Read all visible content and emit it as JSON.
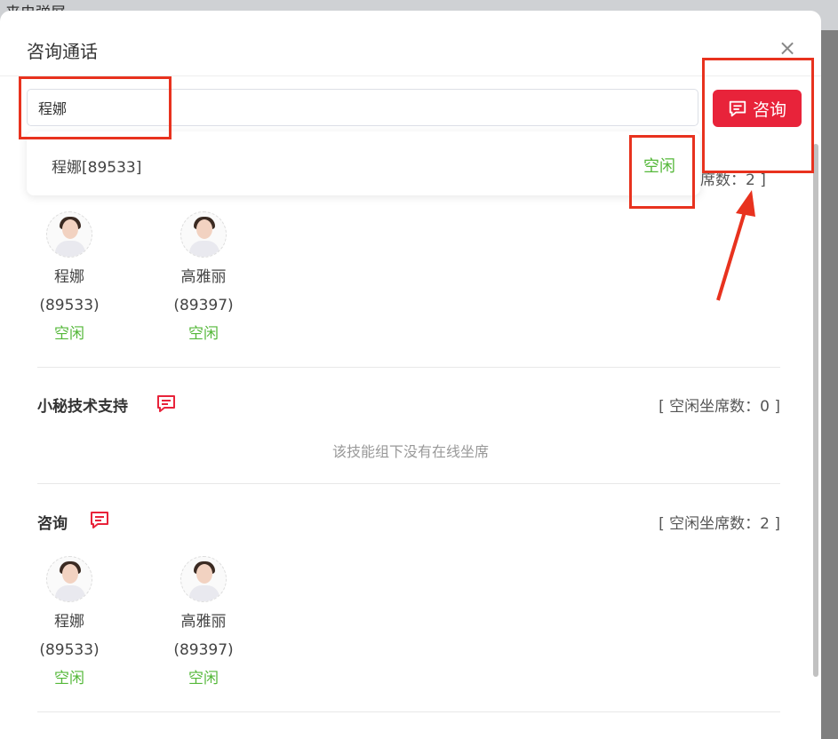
{
  "background": {
    "title": "来电弹屏"
  },
  "modal": {
    "title": "咨询通话",
    "close_symbol": "×",
    "search": {
      "value": "程娜"
    },
    "consult_button": {
      "label": "咨询"
    },
    "dropdown": {
      "name": "程娜[89533]",
      "status": "空闲"
    },
    "first_group_count_partial": "席数：2 ]",
    "groups": [
      {
        "agents": [
          {
            "name": "程娜",
            "id": "(89533)",
            "status": "空闲"
          },
          {
            "name": "高雅丽",
            "id": "(89397)",
            "status": "空闲"
          }
        ]
      },
      {
        "title": "小秘技术支持",
        "count": "[ 空闲坐席数：0 ]",
        "empty": "该技能组下没有在线坐席"
      },
      {
        "title": "咨询",
        "count": "[ 空闲坐席数：2 ]",
        "agents": [
          {
            "name": "程娜",
            "id": "(89533)",
            "status": "空闲"
          },
          {
            "name": "高雅丽",
            "id": "(89397)",
            "status": "空闲"
          }
        ]
      }
    ]
  },
  "colors": {
    "accent": "#e8233a",
    "idle": "#55b83a",
    "annotation": "#e8321e"
  },
  "icons": {
    "chat": "chat-bubble-icon",
    "close": "close-icon"
  }
}
